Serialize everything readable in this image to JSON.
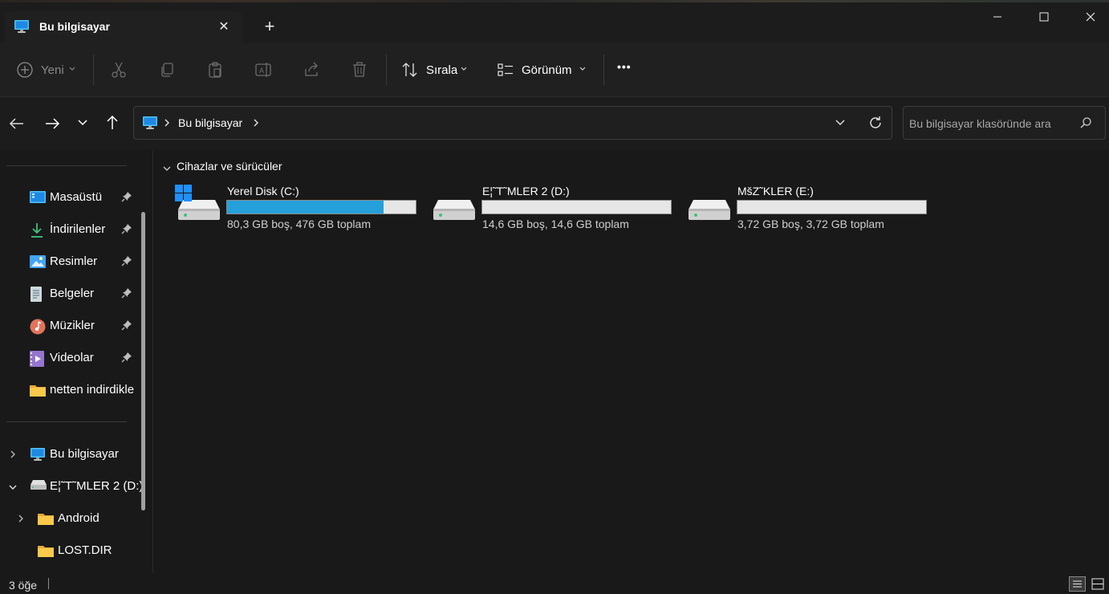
{
  "window": {
    "tab_title": "Bu bilgisayar",
    "new_tab": "+",
    "close_tab": "✕"
  },
  "toolbar": {
    "new_label": "Yeni",
    "sort_label": "Sırala",
    "view_label": "Görünüm",
    "more": "•••"
  },
  "address": {
    "breadcrumb": [
      "Bu bilgisayar"
    ],
    "search_placeholder": "Bu bilgisayar klasöründe ara"
  },
  "sidebar": {
    "quick_access": [
      {
        "label": "Masaüstü",
        "icon": "desktop-icon",
        "pinned": true
      },
      {
        "label": "İndirilenler",
        "icon": "downloads-icon",
        "pinned": true
      },
      {
        "label": "Resimler",
        "icon": "pictures-icon",
        "pinned": true
      },
      {
        "label": "Belgeler",
        "icon": "documents-icon",
        "pinned": true
      },
      {
        "label": "Müzikler",
        "icon": "music-icon",
        "pinned": true
      },
      {
        "label": "Videolar",
        "icon": "videos-icon",
        "pinned": true
      },
      {
        "label": "netten indirdikle",
        "icon": "folder-icon",
        "pinned": false
      }
    ],
    "tree": [
      {
        "label": "Bu bilgisayar",
        "icon": "computer-icon",
        "expanded": false
      },
      {
        "label": "E¦˜T˜MLER 2 (D:)",
        "icon": "drive-icon",
        "expanded": true
      },
      {
        "label": "Android",
        "icon": "folder-icon",
        "expanded": false
      },
      {
        "label": "LOST.DIR",
        "icon": "folder-icon"
      }
    ]
  },
  "main": {
    "section_title": "Cihazlar ve sürücüler",
    "drives": [
      {
        "name": "Yerel Disk (C:)",
        "info": "80,3 GB boş, 476 GB toplam",
        "used_fraction": 0.831,
        "system": true
      },
      {
        "name": "E¦˜T˜MLER 2 (D:)",
        "info": "14,6 GB boş, 14,6 GB toplam",
        "used_fraction": 0.0,
        "system": false
      },
      {
        "name": "MšZ˜KLER (E:)",
        "info": "3,72 GB boş, 3,72 GB toplam",
        "used_fraction": 0.0,
        "system": false
      }
    ]
  },
  "status": {
    "item_count": "3 öğe"
  },
  "colors": {
    "background": "#191919",
    "accent": "#26a0da",
    "folder": "#f8c94a"
  }
}
